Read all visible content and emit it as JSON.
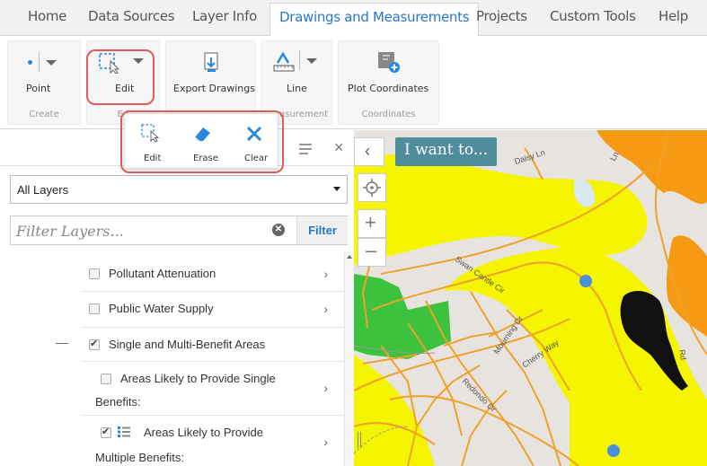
{
  "tabs": [
    "Home",
    "Data Sources",
    "Layer Info",
    "Drawings and Measurements",
    "Projects",
    "Custom Tools",
    "Help"
  ],
  "active_tab": "Drawings and Measurements",
  "ribbon": {
    "groups": {
      "create": "Create",
      "edit_partial": "Ed",
      "measurement_partial": "asurement",
      "coordinates": "Coordinates"
    },
    "buttons": {
      "point": "Point",
      "edit": "Edit",
      "export": "Export Drawings",
      "line": "Line",
      "plot": "Plot Coordinates"
    }
  },
  "popup": {
    "edit": "Edit",
    "erase": "Erase",
    "clear": "Clear"
  },
  "panel": {
    "layers_dropdown": "All Layers",
    "filter_placeholder": "Filter Layers...",
    "filter_button": "Filter",
    "collapse_symbol": "—",
    "items": [
      {
        "label": "Pollutant Attenuation",
        "checked": false
      },
      {
        "label": "Public Water Supply",
        "checked": false
      },
      {
        "label": "Single and Multi-Benefit Areas",
        "checked": true
      },
      {
        "label_line1": "Areas Likely to Provide Single",
        "label_line2": "Benefits:",
        "checked": false
      },
      {
        "label_line1": "Areas Likely to Provide",
        "label_line2": "Multiple Benefits:",
        "checked": true
      }
    ]
  },
  "map": {
    "iwant": "I want to...",
    "streets": [
      "Daisy Ln",
      "Ln",
      "Rd",
      "Cherry Way",
      "Mourning Dr",
      "Redondo Dr",
      "Swan Cantle Cir"
    ],
    "colors": {
      "yellow": "#f5f500",
      "orange_line": "#f0a12a",
      "green": "#3cc23c",
      "orange_fill": "#f59a12",
      "blue_dot": "#4a90d9"
    }
  },
  "colors": {
    "accent": "#2a76c6",
    "highlight": "#e05a5a"
  }
}
